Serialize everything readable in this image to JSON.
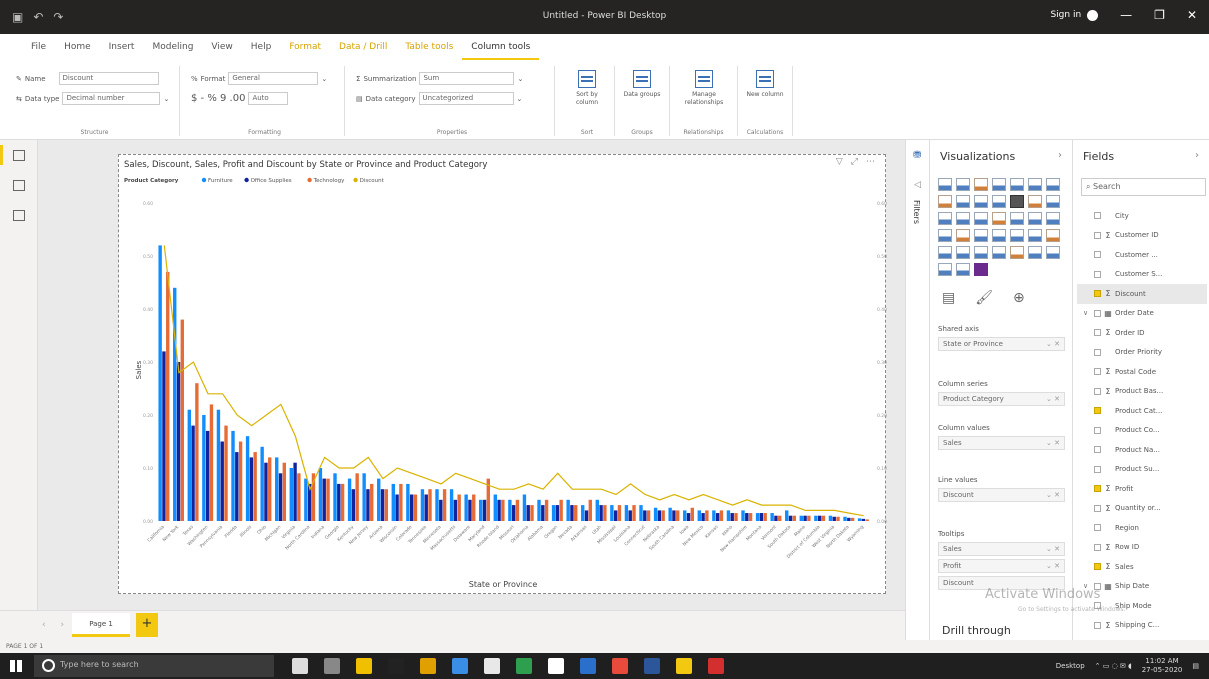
{
  "window": {
    "title": "Untitled - Power BI Desktop",
    "sign_in": "Sign in"
  },
  "ribbon_tabs": [
    {
      "label": "File"
    },
    {
      "label": "Home"
    },
    {
      "label": "Insert"
    },
    {
      "label": "Modeling"
    },
    {
      "label": "View"
    },
    {
      "label": "Help"
    },
    {
      "label": "Format"
    },
    {
      "label": "Data / Drill"
    },
    {
      "label": "Table tools"
    },
    {
      "label": "Column tools"
    }
  ],
  "ribbon": {
    "name_label": "Name",
    "name_value": "Discount",
    "datatype_label": "Data type",
    "datatype_value": "Decimal number",
    "structure_label": "Structure",
    "format_label": "Format",
    "format_value": "General",
    "currency_row": "$ - % 9 .00",
    "auto_value": "Auto",
    "formatting_label": "Formatting",
    "summarization_label": "Summarization",
    "summarization_value": "Sum",
    "datacategory_label": "Data category",
    "datacategory_value": "Uncategorized",
    "properties_label": "Properties",
    "sort_label": "Sort by column",
    "sort_group": "Sort",
    "groups_label": "Data groups",
    "groups_group": "Groups",
    "manage_label": "Manage relationships",
    "rel_group": "Relationships",
    "newcol_label": "New column",
    "calc_group": "Calculations"
  },
  "chart_data": {
    "type": "bar+line",
    "title": "Sales, Discount, Sales, Profit and Discount by State or Province and Product Category",
    "legend_title": "Product Category",
    "legend_position": "top-left",
    "xlabel": "State or Province",
    "ylabel": "Sales",
    "ylim": [
      0,
      0.6
    ],
    "categories": [
      "California",
      "New York",
      "Texas",
      "Washington",
      "Pennsylvania",
      "Florida",
      "Illinois",
      "Ohio",
      "Michigan",
      "Virginia",
      "North Carolina",
      "Indiana",
      "Georgia",
      "Kentucky",
      "New Jersey",
      "Arizona",
      "Wisconsin",
      "Colorado",
      "Tennessee",
      "Minnesota",
      "Massachusetts",
      "Delaware",
      "Maryland",
      "Rhode Island",
      "Missouri",
      "Oklahoma",
      "Alabama",
      "Oregon",
      "Nevada",
      "Arkansas",
      "Utah",
      "Mississippi",
      "Louisiana",
      "Connecticut",
      "Nebraska",
      "South Carolina",
      "Iowa",
      "New Mexico",
      "Kansas",
      "Idaho",
      "New Hampshire",
      "Montana",
      "Vermont",
      "South Dakota",
      "Maine",
      "District of Columbia",
      "West Virginia",
      "North Dakota",
      "Wyoming"
    ],
    "series": [
      {
        "name": "Furniture",
        "color": "#118dff",
        "values": [
          0.52,
          0.44,
          0.21,
          0.2,
          0.21,
          0.17,
          0.16,
          0.14,
          0.12,
          0.1,
          0.08,
          0.1,
          0.09,
          0.08,
          0.09,
          0.08,
          0.07,
          0.07,
          0.06,
          0.06,
          0.06,
          0.05,
          0.04,
          0.05,
          0.04,
          0.05,
          0.04,
          0.03,
          0.04,
          0.03,
          0.04,
          0.03,
          0.03,
          0.03,
          0.025,
          0.025,
          0.02,
          0.02,
          0.02,
          0.02,
          0.02,
          0.015,
          0.015,
          0.02,
          0.01,
          0.01,
          0.01,
          0.008,
          0.005
        ]
      },
      {
        "name": "Office Supplies",
        "color": "#12239e",
        "values": [
          0.32,
          0.3,
          0.18,
          0.17,
          0.15,
          0.13,
          0.12,
          0.11,
          0.09,
          0.11,
          0.07,
          0.08,
          0.07,
          0.06,
          0.06,
          0.06,
          0.05,
          0.05,
          0.05,
          0.04,
          0.04,
          0.04,
          0.04,
          0.04,
          0.03,
          0.03,
          0.03,
          0.03,
          0.03,
          0.02,
          0.03,
          0.02,
          0.02,
          0.02,
          0.02,
          0.02,
          0.015,
          0.015,
          0.015,
          0.015,
          0.015,
          0.015,
          0.01,
          0.01,
          0.01,
          0.01,
          0.008,
          0.006,
          0.004
        ]
      },
      {
        "name": "Technology",
        "color": "#e66c37",
        "values": [
          0.47,
          0.38,
          0.26,
          0.22,
          0.18,
          0.15,
          0.13,
          0.12,
          0.11,
          0.09,
          0.09,
          0.08,
          0.07,
          0.09,
          0.07,
          0.06,
          0.07,
          0.05,
          0.06,
          0.06,
          0.05,
          0.05,
          0.08,
          0.04,
          0.04,
          0.03,
          0.04,
          0.04,
          0.03,
          0.04,
          0.03,
          0.03,
          0.03,
          0.02,
          0.02,
          0.02,
          0.025,
          0.02,
          0.02,
          0.015,
          0.015,
          0.015,
          0.01,
          0.01,
          0.01,
          0.01,
          0.008,
          0.006,
          0.003
        ]
      },
      {
        "name": "Discount",
        "color": "#d9b300",
        "values": [
          0.52,
          0.28,
          0.3,
          0.24,
          0.24,
          0.2,
          0.18,
          0.2,
          0.22,
          0.16,
          0.06,
          0.12,
          0.1,
          0.1,
          0.12,
          0.08,
          0.1,
          0.09,
          0.08,
          0.07,
          0.09,
          0.08,
          0.07,
          0.06,
          0.06,
          0.07,
          0.06,
          0.09,
          0.06,
          0.06,
          0.06,
          0.05,
          0.07,
          0.05,
          0.04,
          0.05,
          0.04,
          0.05,
          0.04,
          0.03,
          0.04,
          0.03,
          0.03,
          0.03,
          0.02,
          0.02,
          0.02,
          0.015,
          0.01
        ]
      }
    ],
    "y_ticks": [
      "0.00",
      "0.10",
      "0.20",
      "0.30",
      "0.40",
      "0.50",
      "0.60"
    ]
  },
  "visual_icons": [
    "filter-icon",
    "focus-icon",
    "more-icon"
  ],
  "filters_label": "Filters",
  "viz_pane": {
    "title": "Visualizations",
    "wells": [
      {
        "label": "Shared axis",
        "value": "State or Province"
      },
      {
        "label": "Column series",
        "value": "Product Category"
      },
      {
        "label": "Column values",
        "value": "Sales"
      },
      {
        "label": "Line values",
        "value": "Discount"
      }
    ],
    "tooltips_label": "Tooltips",
    "tooltips": [
      "Sales",
      "Profit",
      "Discount"
    ],
    "drill_through": "Drill through"
  },
  "fields_pane": {
    "title": "Fields",
    "search_placeholder": "Search",
    "fields": [
      {
        "name": "City",
        "sigma": "",
        "checked": false,
        "hl": false,
        "exp": ""
      },
      {
        "name": "Customer ID",
        "sigma": "Σ",
        "checked": false,
        "hl": false,
        "exp": ""
      },
      {
        "name": "Customer ...",
        "sigma": "",
        "checked": false,
        "hl": false,
        "exp": ""
      },
      {
        "name": "Customer S...",
        "sigma": "",
        "checked": false,
        "hl": false,
        "exp": ""
      },
      {
        "name": "Discount",
        "sigma": "Σ",
        "checked": true,
        "hl": true,
        "exp": ""
      },
      {
        "name": "Order Date",
        "sigma": "▦",
        "checked": false,
        "hl": false,
        "exp": "∨"
      },
      {
        "name": "Order ID",
        "sigma": "Σ",
        "checked": false,
        "hl": false,
        "exp": ""
      },
      {
        "name": "Order Priority",
        "sigma": "",
        "checked": false,
        "hl": false,
        "exp": ""
      },
      {
        "name": "Postal Code",
        "sigma": "Σ",
        "checked": false,
        "hl": false,
        "exp": ""
      },
      {
        "name": "Product Bas...",
        "sigma": "Σ",
        "checked": false,
        "hl": false,
        "exp": ""
      },
      {
        "name": "Product Cat...",
        "sigma": "",
        "checked": true,
        "hl": false,
        "exp": ""
      },
      {
        "name": "Product Co...",
        "sigma": "",
        "checked": false,
        "hl": false,
        "exp": ""
      },
      {
        "name": "Product Na...",
        "sigma": "",
        "checked": false,
        "hl": false,
        "exp": ""
      },
      {
        "name": "Product Su...",
        "sigma": "",
        "checked": false,
        "hl": false,
        "exp": ""
      },
      {
        "name": "Profit",
        "sigma": "Σ",
        "checked": true,
        "hl": false,
        "exp": ""
      },
      {
        "name": "Quantity or...",
        "sigma": "Σ",
        "checked": false,
        "hl": false,
        "exp": ""
      },
      {
        "name": "Region",
        "sigma": "",
        "checked": false,
        "hl": false,
        "exp": ""
      },
      {
        "name": "Row ID",
        "sigma": "Σ",
        "checked": false,
        "hl": false,
        "exp": ""
      },
      {
        "name": "Sales",
        "sigma": "Σ",
        "checked": true,
        "hl": false,
        "exp": ""
      },
      {
        "name": "Ship Date",
        "sigma": "▦",
        "checked": false,
        "hl": false,
        "exp": "∨"
      },
      {
        "name": "Ship Mode",
        "sigma": "",
        "checked": false,
        "hl": false,
        "exp": ""
      },
      {
        "name": "Shipping C...",
        "sigma": "Σ",
        "checked": false,
        "hl": false,
        "exp": ""
      }
    ]
  },
  "watermark": {
    "line1": "Activate Windows",
    "line2": "Go to Settings to activate Windows."
  },
  "pages": {
    "page1": "Page 1",
    "add": "+"
  },
  "status": "PAGE 1 OF 1",
  "taskbar": {
    "search_placeholder": "Type here to search",
    "desktop_label": "Desktop",
    "time": "11:02 AM",
    "date": "27-05-2020"
  }
}
